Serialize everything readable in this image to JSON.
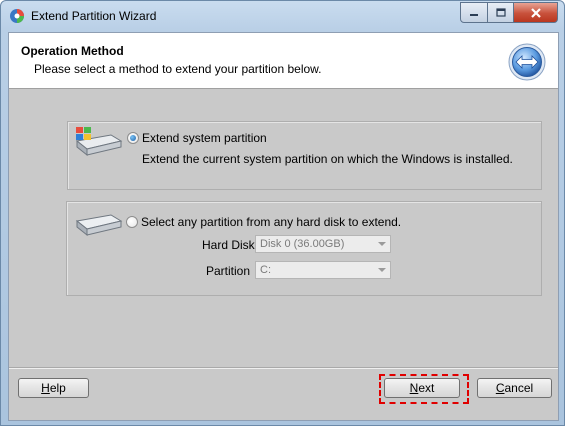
{
  "window": {
    "title": "Extend Partition Wizard",
    "caption_buttons": [
      "minimize",
      "maximize",
      "close"
    ]
  },
  "header": {
    "title": "Operation Method",
    "subtitle": "Please select a method to extend your partition below.",
    "icon": "extend-arrows-icon"
  },
  "options": [
    {
      "label": "Extend system partition",
      "description": "Extend the current system partition on which the Windows is installed.",
      "selected": true,
      "icon": "system-disk-icon"
    },
    {
      "label": "Select any partition from any hard disk to extend.",
      "selected": false,
      "icon": "hard-disk-icon",
      "fields": {
        "hard_disk": {
          "label": "Hard Disk",
          "value": "Disk 0 (36.00GB)",
          "disabled": true
        },
        "partition": {
          "label": "Partition",
          "value": "C:",
          "disabled": true
        }
      }
    }
  ],
  "buttons": {
    "help": {
      "prefix": "",
      "accel": "H",
      "rest": "elp"
    },
    "next": {
      "prefix": "",
      "accel": "N",
      "rest": "ext"
    },
    "cancel": {
      "prefix": "",
      "accel": "C",
      "rest": "ancel"
    }
  },
  "colors": {
    "highlight": "#e00000",
    "radio_selected": "#1c5fa8"
  }
}
